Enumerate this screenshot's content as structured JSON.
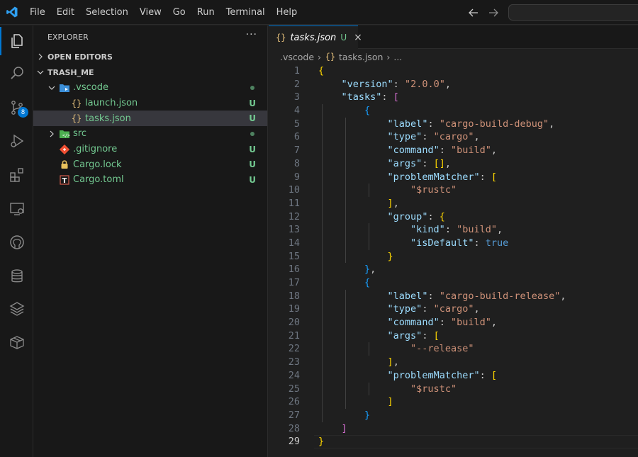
{
  "menu": [
    "File",
    "Edit",
    "Selection",
    "View",
    "Go",
    "Run",
    "Terminal",
    "Help"
  ],
  "activity_badge": "8",
  "sidebar": {
    "title": "EXPLORER",
    "more": "···",
    "open_editors": "OPEN EDITORS",
    "workspace": "TRASH_ME",
    "tree": [
      {
        "label": ".vscode",
        "indent": 1,
        "type": "folder-open",
        "status": "dot"
      },
      {
        "label": "launch.json",
        "indent": 2,
        "type": "json",
        "status": "U"
      },
      {
        "label": "tasks.json",
        "indent": 2,
        "type": "json",
        "status": "U",
        "selected": true
      },
      {
        "label": "src",
        "indent": 1,
        "type": "folder-closed",
        "status": "dot"
      },
      {
        "label": ".gitignore",
        "indent": 1,
        "type": "git",
        "status": "U"
      },
      {
        "label": "Cargo.lock",
        "indent": 1,
        "type": "lock",
        "status": "U"
      },
      {
        "label": "Cargo.toml",
        "indent": 1,
        "type": "toml",
        "status": "U"
      }
    ]
  },
  "editor": {
    "tab": {
      "label": "tasks.json",
      "status": "U",
      "close": "×"
    },
    "breadcrumb": [
      ".vscode",
      "tasks.json",
      "..."
    ],
    "lines": [
      {
        "n": "1",
        "t": [
          [
            "b1",
            "{"
          ]
        ]
      },
      {
        "n": "2",
        "t": [
          [
            "p",
            "    "
          ],
          [
            "k",
            "\"version\""
          ],
          [
            "p",
            ": "
          ],
          [
            "s",
            "\"2.0.0\""
          ],
          [
            "p",
            ","
          ]
        ]
      },
      {
        "n": "3",
        "t": [
          [
            "p",
            "    "
          ],
          [
            "k",
            "\"tasks\""
          ],
          [
            "p",
            ": "
          ],
          [
            "b2",
            "["
          ]
        ]
      },
      {
        "n": "4",
        "t": [
          [
            "p",
            "        "
          ],
          [
            "b3",
            "{"
          ]
        ]
      },
      {
        "n": "5",
        "t": [
          [
            "p",
            "            "
          ],
          [
            "k",
            "\"label\""
          ],
          [
            "p",
            ": "
          ],
          [
            "s",
            "\"cargo-build-debug\""
          ],
          [
            "p",
            ","
          ]
        ]
      },
      {
        "n": "6",
        "t": [
          [
            "p",
            "            "
          ],
          [
            "k",
            "\"type\""
          ],
          [
            "p",
            ": "
          ],
          [
            "s",
            "\"cargo\""
          ],
          [
            "p",
            ","
          ]
        ]
      },
      {
        "n": "7",
        "t": [
          [
            "p",
            "            "
          ],
          [
            "k",
            "\"command\""
          ],
          [
            "p",
            ": "
          ],
          [
            "s",
            "\"build\""
          ],
          [
            "p",
            ","
          ]
        ]
      },
      {
        "n": "8",
        "t": [
          [
            "p",
            "            "
          ],
          [
            "k",
            "\"args\""
          ],
          [
            "p",
            ": "
          ],
          [
            "b1",
            "[]"
          ],
          [
            "p",
            ","
          ]
        ]
      },
      {
        "n": "9",
        "t": [
          [
            "p",
            "            "
          ],
          [
            "k",
            "\"problemMatcher\""
          ],
          [
            "p",
            ": "
          ],
          [
            "b1",
            "["
          ]
        ]
      },
      {
        "n": "10",
        "t": [
          [
            "p",
            "                "
          ],
          [
            "s",
            "\"$rustc\""
          ]
        ]
      },
      {
        "n": "11",
        "t": [
          [
            "p",
            "            "
          ],
          [
            "b1",
            "]"
          ],
          [
            "p",
            ","
          ]
        ]
      },
      {
        "n": "12",
        "t": [
          [
            "p",
            "            "
          ],
          [
            "k",
            "\"group\""
          ],
          [
            "p",
            ": "
          ],
          [
            "b1",
            "{"
          ]
        ]
      },
      {
        "n": "13",
        "t": [
          [
            "p",
            "                "
          ],
          [
            "k",
            "\"kind\""
          ],
          [
            "p",
            ": "
          ],
          [
            "s",
            "\"build\""
          ],
          [
            "p",
            ","
          ]
        ]
      },
      {
        "n": "14",
        "t": [
          [
            "p",
            "                "
          ],
          [
            "k",
            "\"isDefault\""
          ],
          [
            "p",
            ": "
          ],
          [
            "kw",
            "true"
          ]
        ]
      },
      {
        "n": "15",
        "t": [
          [
            "p",
            "            "
          ],
          [
            "b1",
            "}"
          ]
        ]
      },
      {
        "n": "16",
        "t": [
          [
            "p",
            "        "
          ],
          [
            "b3",
            "}"
          ],
          [
            "p",
            ","
          ]
        ]
      },
      {
        "n": "17",
        "t": [
          [
            "p",
            "        "
          ],
          [
            "b3",
            "{"
          ]
        ]
      },
      {
        "n": "18",
        "t": [
          [
            "p",
            "            "
          ],
          [
            "k",
            "\"label\""
          ],
          [
            "p",
            ": "
          ],
          [
            "s",
            "\"cargo-build-release\""
          ],
          [
            "p",
            ","
          ]
        ]
      },
      {
        "n": "19",
        "t": [
          [
            "p",
            "            "
          ],
          [
            "k",
            "\"type\""
          ],
          [
            "p",
            ": "
          ],
          [
            "s",
            "\"cargo\""
          ],
          [
            "p",
            ","
          ]
        ]
      },
      {
        "n": "20",
        "t": [
          [
            "p",
            "            "
          ],
          [
            "k",
            "\"command\""
          ],
          [
            "p",
            ": "
          ],
          [
            "s",
            "\"build\""
          ],
          [
            "p",
            ","
          ]
        ]
      },
      {
        "n": "21",
        "t": [
          [
            "p",
            "            "
          ],
          [
            "k",
            "\"args\""
          ],
          [
            "p",
            ": "
          ],
          [
            "b1",
            "["
          ]
        ]
      },
      {
        "n": "22",
        "t": [
          [
            "p",
            "                "
          ],
          [
            "s",
            "\"--release\""
          ]
        ]
      },
      {
        "n": "23",
        "t": [
          [
            "p",
            "            "
          ],
          [
            "b1",
            "]"
          ],
          [
            "p",
            ","
          ]
        ]
      },
      {
        "n": "24",
        "t": [
          [
            "p",
            "            "
          ],
          [
            "k",
            "\"problemMatcher\""
          ],
          [
            "p",
            ": "
          ],
          [
            "b1",
            "["
          ]
        ]
      },
      {
        "n": "25",
        "t": [
          [
            "p",
            "                "
          ],
          [
            "s",
            "\"$rustc\""
          ]
        ]
      },
      {
        "n": "26",
        "t": [
          [
            "p",
            "            "
          ],
          [
            "b1",
            "]"
          ]
        ]
      },
      {
        "n": "27",
        "t": [
          [
            "p",
            "        "
          ],
          [
            "b3",
            "}"
          ]
        ]
      },
      {
        "n": "28",
        "t": [
          [
            "p",
            "    "
          ],
          [
            "b2",
            "]"
          ]
        ]
      },
      {
        "n": "29",
        "t": [
          [
            "b1",
            "}"
          ]
        ],
        "current": true
      }
    ]
  },
  "colors": {
    "accent": "#0078d4",
    "git_untracked": "#73c991",
    "background": "#1f1f1f"
  }
}
